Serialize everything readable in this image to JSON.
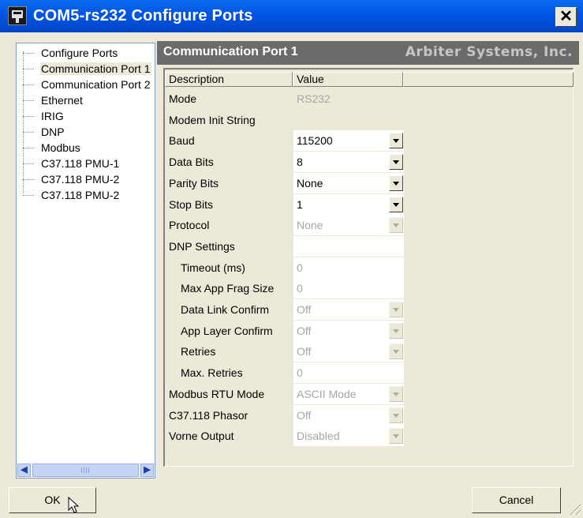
{
  "window": {
    "title": "COM5-rs232 Configure Ports",
    "close_label": "✕"
  },
  "tree": {
    "items": [
      {
        "label": "Configure Ports",
        "selected": false
      },
      {
        "label": "Communication Port 1",
        "selected": true
      },
      {
        "label": "Communication Port 2",
        "selected": false
      },
      {
        "label": "Ethernet",
        "selected": false
      },
      {
        "label": "IRIG",
        "selected": false
      },
      {
        "label": "DNP",
        "selected": false
      },
      {
        "label": "Modbus",
        "selected": false
      },
      {
        "label": "C37.118 PMU-1",
        "selected": false
      },
      {
        "label": "C37.118 PMU-2",
        "selected": false
      },
      {
        "label": "C37.118 PMU-2",
        "selected": false
      }
    ]
  },
  "panel": {
    "title": "Communication Port 1",
    "company": "Arbiter Systems, Inc.",
    "columns": {
      "description": "Description",
      "value": "Value"
    },
    "rows": [
      {
        "desc": "Mode",
        "value": "RS232",
        "indent": false,
        "editable": false,
        "dropdown": "none",
        "white": false
      },
      {
        "desc": "Modem Init String",
        "value": "",
        "indent": false,
        "editable": false,
        "dropdown": "none",
        "white": false
      },
      {
        "desc": "Baud",
        "value": "115200",
        "indent": false,
        "editable": true,
        "dropdown": "enabled",
        "white": true
      },
      {
        "desc": "Data Bits",
        "value": "8",
        "indent": false,
        "editable": true,
        "dropdown": "enabled",
        "white": true
      },
      {
        "desc": "Parity Bits",
        "value": "None",
        "indent": false,
        "editable": true,
        "dropdown": "enabled",
        "white": true
      },
      {
        "desc": "Stop Bits",
        "value": "1",
        "indent": false,
        "editable": true,
        "dropdown": "enabled",
        "white": true
      },
      {
        "desc": "Protocol",
        "value": "None",
        "indent": false,
        "editable": false,
        "dropdown": "disabled",
        "white": true
      },
      {
        "desc": "DNP Settings",
        "value": "",
        "indent": false,
        "editable": false,
        "dropdown": "none",
        "white": true
      },
      {
        "desc": "Timeout (ms)",
        "value": "0",
        "indent": true,
        "editable": false,
        "dropdown": "none",
        "white": true
      },
      {
        "desc": "Max App Frag Size",
        "value": "0",
        "indent": true,
        "editable": false,
        "dropdown": "none",
        "white": true
      },
      {
        "desc": "Data Link Confirm",
        "value": "Off",
        "indent": true,
        "editable": false,
        "dropdown": "disabled",
        "white": true
      },
      {
        "desc": "App Layer Confirm",
        "value": "Off",
        "indent": true,
        "editable": false,
        "dropdown": "disabled",
        "white": true
      },
      {
        "desc": "Retries",
        "value": "Off",
        "indent": true,
        "editable": false,
        "dropdown": "disabled",
        "white": true
      },
      {
        "desc": "Max. Retries",
        "value": "0",
        "indent": true,
        "editable": false,
        "dropdown": "none",
        "white": true
      },
      {
        "desc": "Modbus RTU Mode",
        "value": "ASCII Mode",
        "indent": false,
        "editable": false,
        "dropdown": "disabled",
        "white": true
      },
      {
        "desc": "C37.118 Phasor",
        "value": "Off",
        "indent": false,
        "editable": false,
        "dropdown": "disabled",
        "white": true
      },
      {
        "desc": "Vorne Output",
        "value": "Disabled",
        "indent": false,
        "editable": false,
        "dropdown": "disabled",
        "white": true
      }
    ]
  },
  "buttons": {
    "ok": "OK",
    "cancel": "Cancel"
  },
  "colors": {
    "title_bar": "#0054e3",
    "header_bg": "#6b6b6b",
    "window_bg": "#ece9d8",
    "disabled_text": "#a6a6a6"
  }
}
